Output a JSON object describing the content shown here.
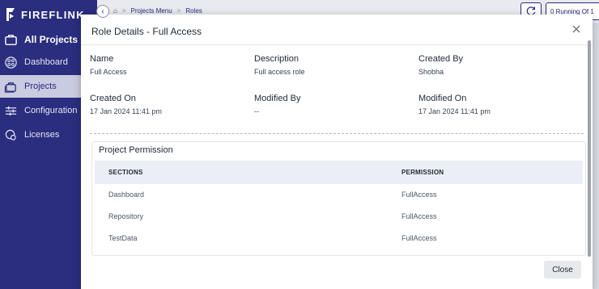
{
  "app": {
    "brand": "FIREFLINK"
  },
  "sidebar": {
    "items": [
      {
        "label": "All Projects",
        "icon": "briefcase-icon"
      },
      {
        "label": "Dashboard",
        "icon": "dashboard-icon"
      },
      {
        "label": "Projects",
        "icon": "projects-icon",
        "active": true
      },
      {
        "label": "Configuration",
        "icon": "sliders-icon"
      },
      {
        "label": "Licenses",
        "icon": "license-icon"
      }
    ]
  },
  "topbar": {
    "breadcrumb": [
      "Projects Menu",
      "Roles"
    ],
    "running_label": "0 Running Of 1"
  },
  "modal": {
    "title": "Role Details - Full Access",
    "fields": [
      {
        "label": "Name",
        "value": "Full Access"
      },
      {
        "label": "Description",
        "value": "Full access role"
      },
      {
        "label": "Created By",
        "value": "Shobha"
      },
      {
        "label": "Created On",
        "value": "17 Jan 2024 11:41 pm"
      },
      {
        "label": "Modified By",
        "value": "--"
      },
      {
        "label": "Modified On",
        "value": "17 Jan 2024 11:41 pm"
      }
    ],
    "permission": {
      "title": "Project Permission",
      "headers": {
        "sections": "SECTIONS",
        "permission": "PERMISSION"
      },
      "rows": [
        {
          "section": "Dashboard",
          "permission": "FullAccess"
        },
        {
          "section": "Repository",
          "permission": "FullAccess"
        },
        {
          "section": "TestData",
          "permission": "FullAccess"
        }
      ]
    },
    "close_label": "Close"
  },
  "colors": {
    "sidebar_bg": "#2b2d7e",
    "active_item_bg": "#c9cbe0",
    "table_header_bg": "#eceef6"
  }
}
